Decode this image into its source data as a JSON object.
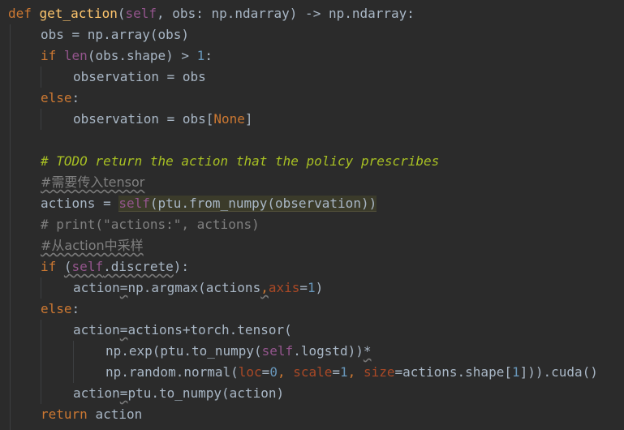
{
  "editor": {
    "background": "#2b2b2b",
    "lines": [
      [
        {
          "t": "def ",
          "c": "kw"
        },
        {
          "t": "get_action",
          "c": "fn"
        },
        {
          "t": "(",
          "c": "plain"
        },
        {
          "t": "self",
          "c": "selfc"
        },
        {
          "t": ", obs: np.ndarray) -> np.ndarray:",
          "c": "plain"
        }
      ],
      [
        {
          "t": "obs = np.array(obs)",
          "c": "plain"
        }
      ],
      [
        {
          "t": "if ",
          "c": "kw"
        },
        {
          "t": "len",
          "c": "selfc"
        },
        {
          "t": "(obs.shape) > ",
          "c": "plain"
        },
        {
          "t": "1",
          "c": "num"
        },
        {
          "t": ":",
          "c": "plain"
        }
      ],
      [
        {
          "t": "observation = obs",
          "c": "plain"
        }
      ],
      [
        {
          "t": "else",
          "c": "kw"
        },
        {
          "t": ":",
          "c": "plain"
        }
      ],
      [
        {
          "t": "observation = obs[",
          "c": "plain"
        },
        {
          "t": "None",
          "c": "kw"
        },
        {
          "t": "]",
          "c": "plain"
        }
      ],
      [],
      [
        {
          "t": "# TODO return the action that the policy prescribes",
          "c": "todo"
        }
      ],
      [
        {
          "t": "#需要传入tensor",
          "c": "cmt",
          "u": true
        }
      ],
      [
        {
          "t": "actions = ",
          "c": "plain"
        },
        {
          "t": "self",
          "c": "selfc",
          "h": true
        },
        {
          "t": "(ptu.from_numpy(observation))",
          "c": "plain",
          "h": true
        }
      ],
      [
        {
          "t": "# print(\"actions:\", actions)",
          "c": "cmt"
        }
      ],
      [
        {
          "t": "#从action中采样",
          "c": "cmt",
          "u": true
        }
      ],
      [
        {
          "t": "if ",
          "c": "kw"
        },
        {
          "t": "(",
          "c": "plain",
          "u": true
        },
        {
          "t": "self",
          "c": "selfc",
          "u": true
        },
        {
          "t": ".discrete",
          "c": "plain",
          "u": true
        },
        {
          "t": "):",
          "c": "plain"
        }
      ],
      [
        {
          "t": "action",
          "c": "plain"
        },
        {
          "t": "=",
          "c": "plain",
          "u": true
        },
        {
          "t": "np.argmax(actions",
          "c": "plain"
        },
        {
          "t": ",",
          "c": "kw",
          "u": true
        },
        {
          "t": "axis",
          "c": "kwarg"
        },
        {
          "t": "=",
          "c": "plain"
        },
        {
          "t": "1",
          "c": "num"
        },
        {
          "t": ")",
          "c": "plain"
        }
      ],
      [
        {
          "t": "else",
          "c": "kw"
        },
        {
          "t": ":",
          "c": "plain"
        }
      ],
      [
        {
          "t": "action",
          "c": "plain"
        },
        {
          "t": "=",
          "c": "plain",
          "u": true
        },
        {
          "t": "actions+torch.tensor(",
          "c": "plain"
        }
      ],
      [
        {
          "t": "np.exp(ptu.to_numpy(",
          "c": "plain"
        },
        {
          "t": "self",
          "c": "selfc"
        },
        {
          "t": ".logstd))",
          "c": "plain"
        },
        {
          "t": "*",
          "c": "plain",
          "u": true
        }
      ],
      [
        {
          "t": "np.random.normal(",
          "c": "plain"
        },
        {
          "t": "loc",
          "c": "kwarg"
        },
        {
          "t": "=",
          "c": "plain"
        },
        {
          "t": "0",
          "c": "num"
        },
        {
          "t": ", ",
          "c": "kw"
        },
        {
          "t": "scale",
          "c": "kwarg"
        },
        {
          "t": "=",
          "c": "plain"
        },
        {
          "t": "1",
          "c": "num"
        },
        {
          "t": ", ",
          "c": "kw"
        },
        {
          "t": "size",
          "c": "kwarg"
        },
        {
          "t": "=actions.shape[",
          "c": "plain"
        },
        {
          "t": "1",
          "c": "num"
        },
        {
          "t": "])).cuda()",
          "c": "plain"
        }
      ],
      [
        {
          "t": "action",
          "c": "plain"
        },
        {
          "t": "=",
          "c": "plain",
          "u": true
        },
        {
          "t": "ptu.to_numpy(action)",
          "c": "plain"
        }
      ],
      [
        {
          "t": "return ",
          "c": "kw"
        },
        {
          "t": "action",
          "c": "plain"
        }
      ]
    ]
  }
}
